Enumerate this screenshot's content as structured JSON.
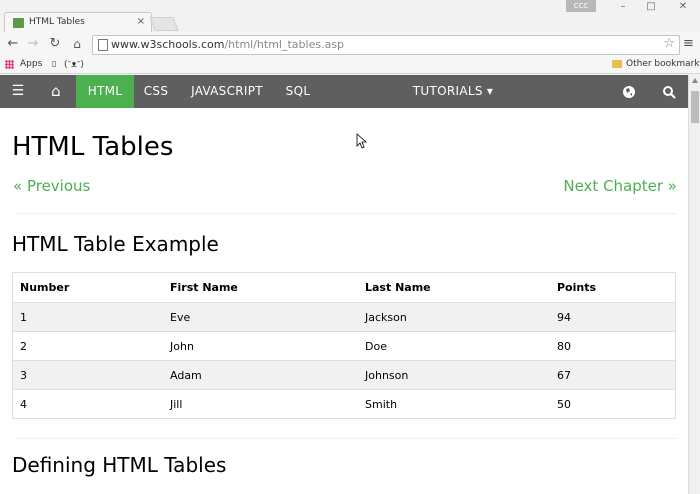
{
  "browser": {
    "tab_title": "HTML Tables",
    "tab_close": "×",
    "user_badge": "CCC",
    "window_minimize": "–",
    "window_maximize": "□",
    "window_close": "✕",
    "url_host": "www.w3schools.com",
    "url_path": "/html/html_tables.asp",
    "bookmarks": {
      "apps": "Apps",
      "item": "(ᵔᴥᵔ)",
      "other": "Other bookmarks"
    }
  },
  "nav": {
    "menu": "☰",
    "home": "⌂",
    "items": [
      "HTML",
      "CSS",
      "JAVASCRIPT",
      "SQL"
    ],
    "tutorials": "TUTORIALS ▾"
  },
  "page": {
    "title": "HTML Tables",
    "prev": "« Previous",
    "next": "Next Chapter »",
    "example_heading": "HTML Table Example",
    "next_heading": "Defining HTML Tables",
    "table": {
      "headers": [
        "Number",
        "First Name",
        "Last Name",
        "Points"
      ],
      "rows": [
        [
          "1",
          "Eve",
          "Jackson",
          "94"
        ],
        [
          "2",
          "John",
          "Doe",
          "80"
        ],
        [
          "3",
          "Adam",
          "Johnson",
          "67"
        ],
        [
          "4",
          "Jill",
          "Smith",
          "50"
        ]
      ]
    }
  }
}
